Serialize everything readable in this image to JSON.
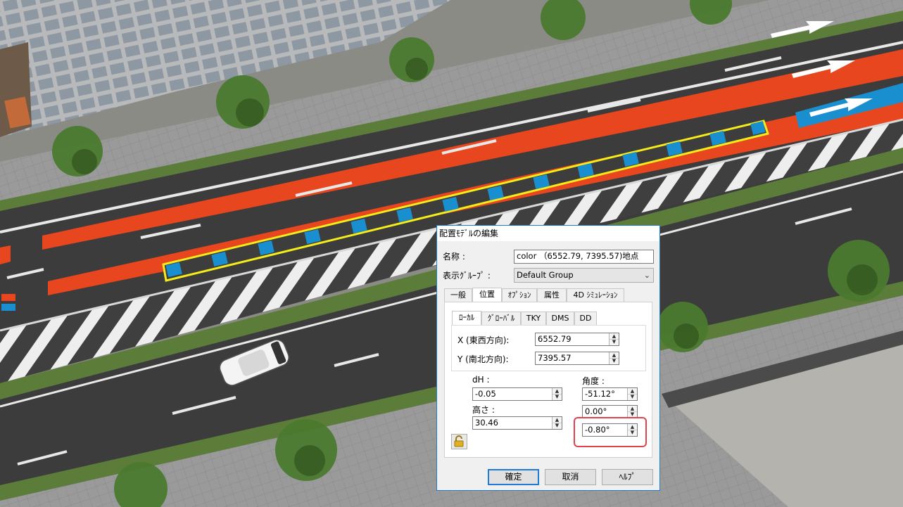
{
  "dialog": {
    "title": "配置ﾓﾃﾞﾙの編集",
    "name_label": "名称 :",
    "name_value": "color （6552.79, 7395.57)地点",
    "group_label": "表示ｸﾞﾙｰﾌﾟ :",
    "group_value": "Default Group",
    "tabs": [
      "一般",
      "位置",
      "ｵﾌﾟｼｮﾝ",
      "属性",
      "4D ｼﾐｭﾚｰｼｮﾝ"
    ],
    "subtabs": [
      "ﾛｰｶﾙ",
      "ｸﾞﾛｰﾊﾞﾙ",
      "TKY",
      "DMS",
      "DD"
    ],
    "x_label": "X (東西方向):",
    "x_value": "6552.79",
    "y_label": "Y (南北方向):",
    "y_value": "7395.57",
    "dh_label": "dH :",
    "dh_value": "-0.05",
    "height_label": "高さ :",
    "height_value": "30.46",
    "angle_label": "角度 :",
    "angle1_value": "-51.12°",
    "angle2_value": "0.00°",
    "angle3_value": "-0.80°",
    "ok_label": "確定",
    "cancel_label": "取消",
    "help_label": "ﾍﾙﾌﾟ"
  },
  "colors": {
    "accent": "#1f7ad8",
    "highlight_box": "#e2424c",
    "bus_lane": "#e8461e",
    "selection": "#f5ec1a",
    "marker": "#1a8fd0"
  }
}
